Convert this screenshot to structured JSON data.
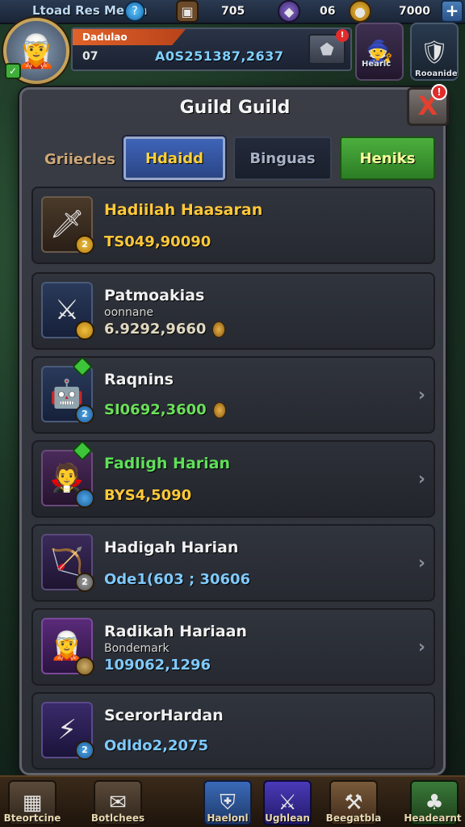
{
  "topbar": {
    "player_name": "Ltoad Res Meron",
    "gem_glyph": "?",
    "resources": [
      {
        "icon": "chest-icon",
        "value": "705"
      },
      {
        "icon": "crystal-icon",
        "value": "06"
      },
      {
        "icon": "gold-coin-icon",
        "value": "7000"
      }
    ],
    "plus_label": "+"
  },
  "player": {
    "tag": "Dadulao",
    "level": "07",
    "power": "A0S251387,2637"
  },
  "side": {
    "right_top_label": "Hearlc",
    "right_top2_label": "Rooanide"
  },
  "modal": {
    "title": "Guild Guild",
    "close_label": "X",
    "tab_caption": "Griiecles",
    "tabs": [
      {
        "label": "Hdaidd",
        "state": "active"
      },
      {
        "label": "Binguas",
        "state": "normal"
      },
      {
        "label": "Heniks",
        "state": "green"
      }
    ],
    "rows": [
      {
        "name": "Hadiilah Haasaran",
        "sub": "",
        "value": "TS049,90090",
        "badge": "2",
        "show_chevron": false,
        "show_coin": false
      },
      {
        "name": "Patmoakias",
        "sub": "oonnane",
        "value": "6.9292,9660",
        "badge": "",
        "show_chevron": false,
        "show_coin": true
      },
      {
        "name": "Raqnins",
        "sub": "",
        "value": "SI0692,3600",
        "badge": "2",
        "show_chevron": true,
        "show_coin": true
      },
      {
        "name": "Fadligh Harian",
        "sub": "",
        "value": "BYS4,5090",
        "badge": "",
        "show_chevron": true,
        "show_coin": false
      },
      {
        "name": "Hadigah Harian",
        "sub": "",
        "value": "Ode1(603 ; 30606",
        "badge": "2",
        "show_chevron": true,
        "show_coin": false
      },
      {
        "name": "Radikah Hariaan",
        "sub": "Bondemark",
        "value": "109062,1296",
        "badge": "",
        "show_chevron": true,
        "show_coin": false
      },
      {
        "name": "ScerorHardan",
        "sub": "",
        "value": "Odldo2,2075",
        "badge": "2",
        "show_chevron": false,
        "show_coin": false
      }
    ]
  },
  "bottombar": {
    "items": [
      {
        "label": "Bteortcine"
      },
      {
        "label": "Botlchees"
      },
      {
        "label": "Haelonl"
      },
      {
        "label": "Ughlean"
      },
      {
        "label": "Beegatbla"
      },
      {
        "label": "Headearnt"
      }
    ]
  }
}
